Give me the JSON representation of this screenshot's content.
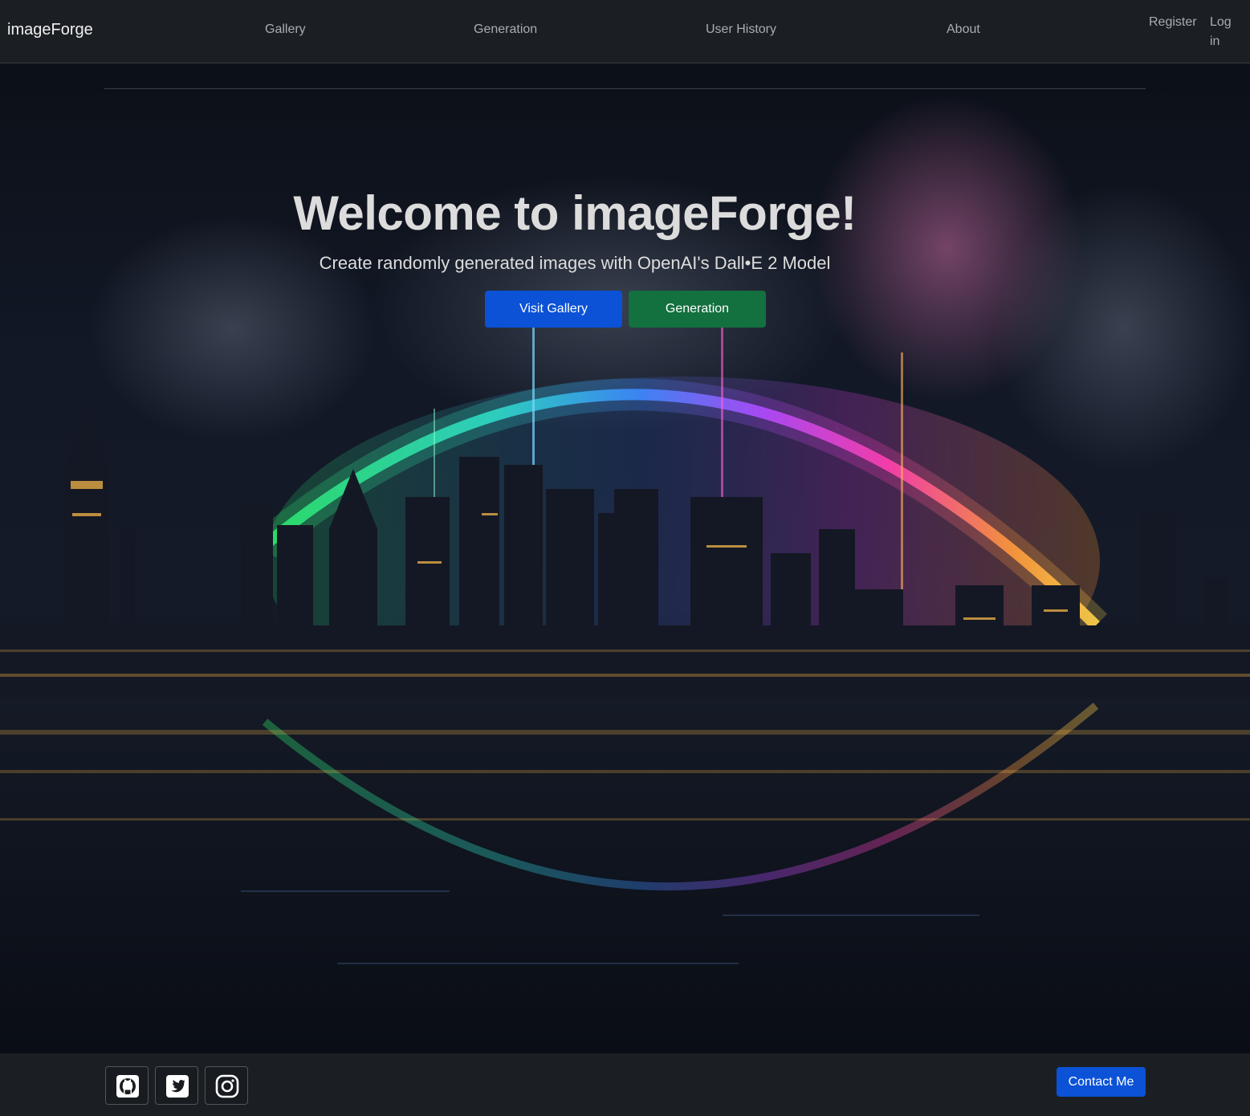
{
  "nav": {
    "brand": "imageForge",
    "links": [
      "Gallery",
      "Generation",
      "User History",
      "About"
    ],
    "register": "Register",
    "login": "Log in"
  },
  "hero": {
    "title": "Welcome to imageForge!",
    "subtitle": "Create randomly generated images with OpenAI's Dall•E 2 Model",
    "primary_button": "Visit Gallery",
    "secondary_button": "Generation"
  },
  "footer": {
    "social_icons": [
      "github-icon",
      "twitter-icon",
      "instagram-icon"
    ],
    "contact_button": "Contact Me"
  },
  "colors": {
    "navbar_bg": "#1b1f23",
    "primary_blue": "#0b52d6",
    "success_green": "#13703f"
  }
}
